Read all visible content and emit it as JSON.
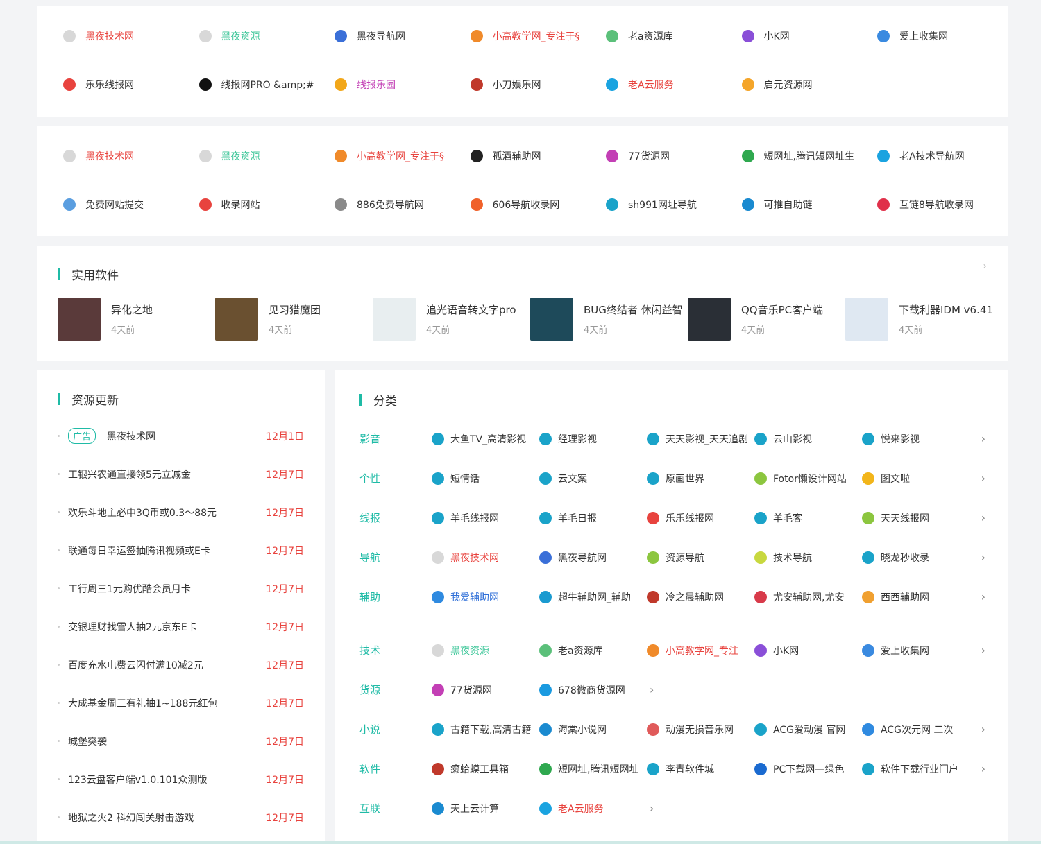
{
  "colors": {
    "accent": "#1fbba6",
    "red": "#e8433e",
    "green_text": "#3fc79a",
    "magenta": "#c33fb5",
    "blue_link": "#2f6fd8"
  },
  "links_block_1": [
    {
      "label": "黑夜技术网",
      "color": "#e8433e",
      "icon": "site-logo-icon",
      "icolor": "#d8d8d8"
    },
    {
      "label": "黑夜资源",
      "color": "#3fc79a",
      "icon": "site-logo-icon",
      "icolor": "#d8d8d8"
    },
    {
      "label": "黑夜导航网",
      "color": "#333",
      "icon": "flame-icon",
      "icolor": "#3a6fd8"
    },
    {
      "label": "小高教学网_专注于§",
      "color": "#e8433e",
      "icon": "badge-check-icon",
      "icolor": "#f08a2a"
    },
    {
      "label": "老a资源库",
      "color": "#333",
      "icon": "triangle-knot-icon",
      "icolor": "#5bc07a"
    },
    {
      "label": "小K网",
      "color": "#333",
      "icon": "k-letter-icon",
      "icolor": "#8a4fd8"
    },
    {
      "label": "爱上收集网",
      "color": "#333",
      "icon": "doraemon-icon",
      "icolor": "#3a8ae0"
    },
    {
      "label": "乐乐线报网",
      "color": "#333",
      "icon": "le-icon",
      "icolor": "#e8433e"
    },
    {
      "label": "线报网PRO &amp;#",
      "color": "#333",
      "icon": "paper-plane-icon",
      "icolor": "#111"
    },
    {
      "label": "线报乐园",
      "color": "#c33fb5",
      "icon": "tiger-icon",
      "icolor": "#f2a71a"
    },
    {
      "label": "小刀娱乐网",
      "color": "#333",
      "icon": "xiaodao-icon",
      "icolor": "#c0392b"
    },
    {
      "label": "老A云服务",
      "color": "#e8433e",
      "icon": "water-drop-icon",
      "icolor": "#1aa3e0"
    },
    {
      "label": "启元资源网",
      "color": "#333",
      "icon": "orange-slice-icon",
      "icolor": "#f4a52a"
    }
  ],
  "links_block_2": [
    {
      "label": "黑夜技术网",
      "color": "#e8433e",
      "icon": "site-logo-icon",
      "icolor": "#d8d8d8"
    },
    {
      "label": "黑夜资源",
      "color": "#3fc79a",
      "icon": "site-logo-icon",
      "icolor": "#d8d8d8"
    },
    {
      "label": "小高教学网_专注于§",
      "color": "#e8433e",
      "icon": "badge-check-icon",
      "icolor": "#f08a2a"
    },
    {
      "label": "孤酒辅助网",
      "color": "#333",
      "icon": "qq-penguin-icon",
      "icolor": "#222"
    },
    {
      "label": "77货源网",
      "color": "#333",
      "icon": "seven-icon",
      "icolor": "#c33fb5"
    },
    {
      "label": "短网址,腾讯短网址生",
      "color": "#333",
      "icon": "g-letter-icon",
      "icolor": "#2fa84f"
    },
    {
      "label": "老A技术导航网",
      "color": "#333",
      "icon": "water-drop-icon",
      "icolor": "#1aa3e0"
    },
    {
      "label": "免费网站提交",
      "color": "#333",
      "icon": "send-circle-icon",
      "icolor": "#5a9ee0"
    },
    {
      "label": "收录网站",
      "color": "#333",
      "icon": "fire-circle-icon",
      "icolor": "#e8433e"
    },
    {
      "label": "886免费导航网",
      "color": "#333",
      "icon": "avatar-icon",
      "icolor": "#8a8a8a"
    },
    {
      "label": "606导航收录网",
      "color": "#333",
      "icon": "six-icon",
      "icolor": "#f0612a"
    },
    {
      "label": "sh991网址导航",
      "color": "#333",
      "icon": "browser-e-icon",
      "icolor": "#1aa3c9"
    },
    {
      "label": "可推自助链",
      "color": "#333",
      "icon": "wave-icon",
      "icolor": "#1a8ad0"
    },
    {
      "label": "互链8导航收录网",
      "color": "#333",
      "icon": "eight-icon",
      "icolor": "#e0304a"
    }
  ],
  "software": {
    "title": "实用软件",
    "more": "›",
    "items": [
      {
        "name": "异化之地",
        "time": "4天前",
        "thumb": "#5a3a3a"
      },
      {
        "name": "见习猎魔团",
        "time": "4天前",
        "thumb": "#6a5030"
      },
      {
        "name": "追光语音转文字pro",
        "time": "4天前",
        "thumb": "#e8eef0"
      },
      {
        "name": "BUG终结者 休闲益智",
        "time": "4天前",
        "thumb": "#1e4a5a"
      },
      {
        "name": "QQ音乐PC客户端",
        "time": "4天前",
        "thumb": "#2a2f36"
      },
      {
        "name": "下载利器IDM v6.41",
        "time": "4天前",
        "thumb": "#dfe8f2"
      }
    ]
  },
  "updates": {
    "title": "资源更新",
    "items": [
      {
        "ad": "广告",
        "title": "黑夜技术网",
        "date": "12月1日"
      },
      {
        "ad": "",
        "title": "工银兴农通直接领5元立减金",
        "date": "12月7日"
      },
      {
        "ad": "",
        "title": "欢乐斗地主必中3Q币或0.3～88元",
        "date": "12月7日"
      },
      {
        "ad": "",
        "title": "联通每日幸运签抽腾讯视频或E卡",
        "date": "12月7日"
      },
      {
        "ad": "",
        "title": "工行周三1元购优酷会员月卡",
        "date": "12月7日"
      },
      {
        "ad": "",
        "title": "交银理财找雪人抽2元京东E卡",
        "date": "12月7日"
      },
      {
        "ad": "",
        "title": "百度充水电费云闪付满10减2元",
        "date": "12月7日"
      },
      {
        "ad": "",
        "title": "大成基金周三有礼抽1~188元红包",
        "date": "12月7日"
      },
      {
        "ad": "",
        "title": "城堡突袭",
        "date": "12月7日"
      },
      {
        "ad": "",
        "title": "123云盘客户端v1.0.101众测版",
        "date": "12月7日"
      },
      {
        "ad": "",
        "title": "地狱之火2 科幻闯关射击游戏",
        "date": "12月7日"
      }
    ]
  },
  "categories": {
    "title": "分类",
    "more": "›",
    "group1": [
      {
        "name": "影音",
        "items": [
          {
            "label": "大鱼TV_高清影视",
            "icon": "browser-e-icon",
            "icolor": "#1aa3c9",
            "color": "#333"
          },
          {
            "label": "经理影视",
            "icon": "browser-e-icon",
            "icolor": "#1aa3c9",
            "color": "#333"
          },
          {
            "label": "天天影视_天天追剧",
            "icon": "browser-e-icon",
            "icolor": "#1aa3c9",
            "color": "#333"
          },
          {
            "label": "云山影视",
            "icon": "browser-e-icon",
            "icolor": "#1aa3c9",
            "color": "#333"
          },
          {
            "label": "悦来影视",
            "icon": "browser-e-icon",
            "icolor": "#1aa3c9",
            "color": "#333"
          }
        ]
      },
      {
        "name": "个性",
        "items": [
          {
            "label": "短情话",
            "icon": "browser-e-icon",
            "icolor": "#1aa3c9",
            "color": "#333"
          },
          {
            "label": "云文案",
            "icon": "browser-e-icon",
            "icolor": "#1aa3c9",
            "color": "#333"
          },
          {
            "label": "原画世界",
            "icon": "browser-e-icon",
            "icolor": "#1aa3c9",
            "color": "#333"
          },
          {
            "label": "Fotor懒设计网站",
            "icon": "leaf-icon",
            "icolor": "#8cc63f",
            "color": "#333"
          },
          {
            "label": "图文啦",
            "icon": "star-face-icon",
            "icolor": "#f2b51a",
            "color": "#333"
          }
        ]
      },
      {
        "name": "线报",
        "items": [
          {
            "label": "羊毛线报网",
            "icon": "browser-e-icon",
            "icolor": "#1aa3c9",
            "color": "#333"
          },
          {
            "label": "羊毛日报",
            "icon": "browser-e-icon",
            "icolor": "#1aa3c9",
            "color": "#333"
          },
          {
            "label": "乐乐线报网",
            "icon": "le-icon",
            "icolor": "#e8433e",
            "color": "#333"
          },
          {
            "label": "羊毛客",
            "icon": "browser-e-icon",
            "icolor": "#1aa3c9",
            "color": "#333"
          },
          {
            "label": "天天线报网",
            "icon": "leaf-icon",
            "icolor": "#8cc63f",
            "color": "#333"
          }
        ]
      },
      {
        "name": "导航",
        "items": [
          {
            "label": "黑夜技术网",
            "icon": "site-logo-icon",
            "icolor": "#d8d8d8",
            "color": "#e8433e"
          },
          {
            "label": "黑夜导航网",
            "icon": "flame-icon",
            "icolor": "#3a6fd8",
            "color": "#333"
          },
          {
            "label": "资源导航",
            "icon": "diamond-icon",
            "icolor": "#8cc63f",
            "color": "#333"
          },
          {
            "label": "技术导航",
            "icon": "diamond-icon",
            "icolor": "#c8d83f",
            "color": "#333"
          },
          {
            "label": "晓龙秒收录",
            "icon": "browser-e-icon",
            "icolor": "#1aa3c9",
            "color": "#333"
          }
        ]
      },
      {
        "name": "辅助",
        "items": [
          {
            "label": "我爱辅助网",
            "icon": "square-pen-icon",
            "icolor": "#2f8ae0",
            "color": "#2f6fd8"
          },
          {
            "label": "超牛辅助网_辅助",
            "icon": "cn-logo-icon",
            "icolor": "#1a9ad0",
            "color": "#333"
          },
          {
            "label": "冷之晨辅助网",
            "icon": "bubble-icon",
            "icolor": "#c0392b",
            "color": "#333"
          },
          {
            "label": "尤安辅助网,尤安",
            "icon": "m-logo-icon",
            "icolor": "#d83a4a",
            "color": "#333"
          },
          {
            "label": "西西辅助网",
            "icon": "x-logo-icon",
            "icolor": "#f0a030",
            "color": "#333"
          }
        ]
      }
    ],
    "group2": [
      {
        "name": "技术",
        "items": [
          {
            "label": "黑夜资源",
            "icon": "site-logo-icon",
            "icolor": "#d8d8d8",
            "color": "#3fc79a"
          },
          {
            "label": "老a资源库",
            "icon": "triangle-knot-icon",
            "icolor": "#5bc07a",
            "color": "#333"
          },
          {
            "label": "小高教学网_专注",
            "icon": "badge-check-icon",
            "icolor": "#f08a2a",
            "color": "#e8433e"
          },
          {
            "label": "小K网",
            "icon": "k-letter-icon",
            "icolor": "#8a4fd8",
            "color": "#333"
          },
          {
            "label": "爱上收集网",
            "icon": "doraemon-icon",
            "icolor": "#3a8ae0",
            "color": "#333"
          }
        ],
        "chev": true
      },
      {
        "name": "货源",
        "items": [
          {
            "label": "77货源网",
            "icon": "seven-icon",
            "icolor": "#c33fb5",
            "color": "#333"
          },
          {
            "label": "678微商货源网",
            "icon": "678-logo-icon",
            "icolor": "#1a9ae0",
            "color": "#333"
          }
        ],
        "chev": false
      },
      {
        "name": "小说",
        "items": [
          {
            "label": "古籍下载,高清古籍",
            "icon": "browser-e-icon",
            "icolor": "#1aa3c9",
            "color": "#333"
          },
          {
            "label": "海棠小说网",
            "icon": "book-circle-icon",
            "icolor": "#1a8ad0",
            "color": "#333"
          },
          {
            "label": "动漫无损音乐网",
            "icon": "music-note-icon",
            "icolor": "#e05a5a",
            "color": "#333"
          },
          {
            "label": "ACG爱动漫 官网",
            "icon": "browser-e-icon",
            "icolor": "#1aa3c9",
            "color": "#333"
          },
          {
            "label": "ACG次元网 二次",
            "icon": "404-icon",
            "icolor": "#2f8ae0",
            "color": "#333"
          }
        ],
        "chev": true
      },
      {
        "name": "软件",
        "items": [
          {
            "label": "癞蛤蟆工具箱",
            "icon": "toad-icon",
            "icolor": "#c0392b",
            "color": "#333"
          },
          {
            "label": "短网址,腾讯短网址",
            "icon": "g-letter-icon",
            "icolor": "#2fa84f",
            "color": "#333"
          },
          {
            "label": "李青软件城",
            "icon": "browser-e-icon",
            "icolor": "#1aa3c9",
            "color": "#333"
          },
          {
            "label": "PC下载网—绿色",
            "icon": "globe-icon",
            "icolor": "#1a6ad0",
            "color": "#333"
          },
          {
            "label": "软件下载行业门户",
            "icon": "browser-e-icon",
            "icolor": "#1aa3c9",
            "color": "#333"
          }
        ],
        "chev": true
      },
      {
        "name": "互联",
        "items": [
          {
            "label": "天上云计算",
            "icon": "cloud-icon",
            "icolor": "#1a8ad0",
            "color": "#333"
          },
          {
            "label": "老A云服务",
            "icon": "water-drop-icon",
            "icolor": "#1aa3e0",
            "color": "#e8433e"
          }
        ],
        "chev": false
      }
    ]
  }
}
